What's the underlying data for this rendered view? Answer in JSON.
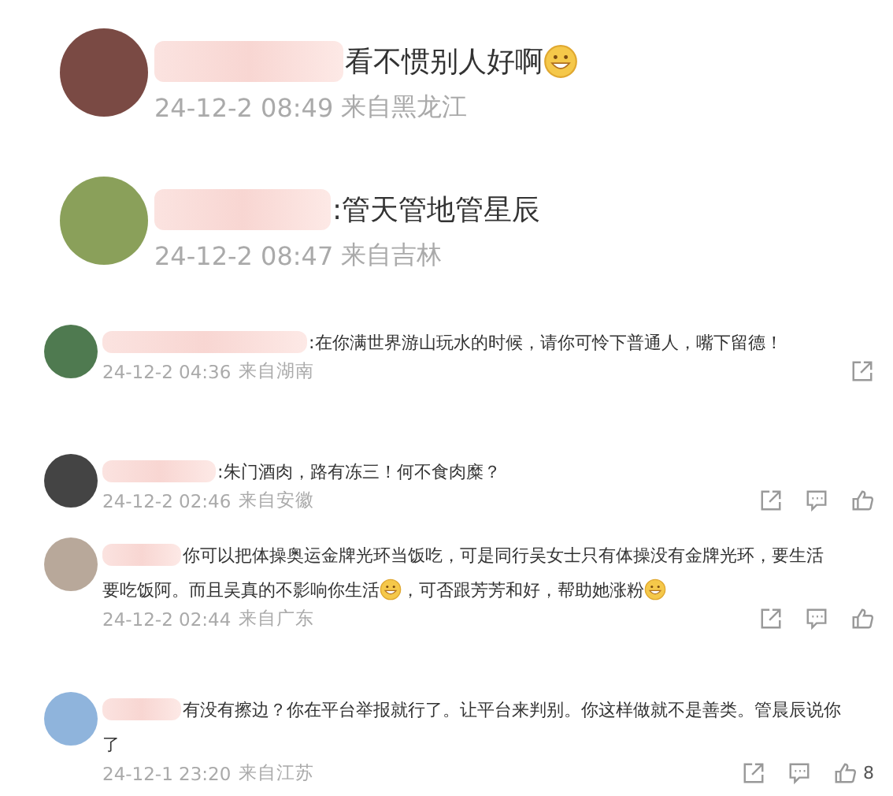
{
  "comments": [
    {
      "kind": "large",
      "lines": [
        [
          {
            "kind": "text",
            "text": "看不惯别人好啊"
          },
          {
            "kind": "emoji"
          }
        ]
      ],
      "time": "24-12-2 08:49",
      "location": "来自黑龙江"
    },
    {
      "kind": "large",
      "lines": [
        [
          {
            "kind": "text",
            "text": ":管天管地管星辰"
          }
        ]
      ],
      "time": "24-12-2 08:47",
      "location": "来自吉林"
    },
    {
      "kind": "small",
      "lines": [
        [
          {
            "kind": "text",
            "text": ":在你满世界游山玩水的时候，请你可怜下普通人，嘴下留德！"
          }
        ]
      ],
      "time": "24-12-2 04:36",
      "location": "来自湖南",
      "actions": [
        {
          "kind": "share"
        }
      ]
    },
    {
      "kind": "small",
      "lines": [
        [
          {
            "kind": "text",
            "text": ":朱门酒肉，路有冻三！何不食肉糜？"
          }
        ]
      ],
      "time": "24-12-2 02:46",
      "location": "来自安徽",
      "actions": [
        {
          "kind": "share"
        },
        {
          "kind": "comment"
        },
        {
          "kind": "like"
        }
      ]
    },
    {
      "kind": "small",
      "lines": [
        [
          {
            "kind": "text",
            "text": "你可以把体操奥运金牌光环当饭吃，可是同行吴女士只有体操没有金牌光环，要生活"
          }
        ],
        [
          {
            "kind": "text",
            "text": "要吃饭阿。而且吴真的不影响你生活"
          },
          {
            "kind": "emoji"
          },
          {
            "kind": "text",
            "text": "，可否跟芳芳和好，帮助她涨粉"
          },
          {
            "kind": "emoji"
          }
        ]
      ],
      "time": "24-12-2 02:44",
      "location": "来自广东",
      "actions": [
        {
          "kind": "share"
        },
        {
          "kind": "comment"
        },
        {
          "kind": "like"
        }
      ]
    },
    {
      "kind": "small",
      "lines": [
        [
          {
            "kind": "text",
            "text": "有没有擦边？你在平台举报就行了。让平台来判别。你这样做就不是善类。管晨辰说你"
          }
        ],
        [
          {
            "kind": "text",
            "text": "了"
          }
        ]
      ],
      "time": "24-12-1 23:20",
      "location": "来自江苏",
      "actions": [
        {
          "kind": "share"
        },
        {
          "kind": "comment"
        },
        {
          "kind": "like",
          "count": "8"
        }
      ]
    }
  ]
}
